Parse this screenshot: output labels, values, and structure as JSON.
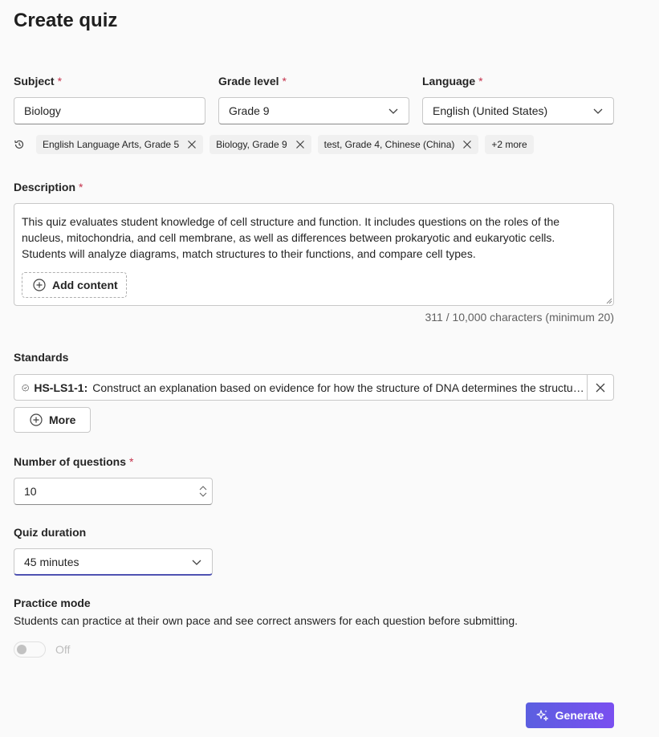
{
  "page": {
    "title": "Create quiz"
  },
  "subject": {
    "label": "Subject",
    "required_mark": "*",
    "value": "Biology"
  },
  "grade": {
    "label": "Grade level",
    "required_mark": "*",
    "value": "Grade 9"
  },
  "language": {
    "label": "Language",
    "required_mark": "*",
    "value": "English (United States)"
  },
  "recent": {
    "icon": "history-icon",
    "chips": [
      {
        "label": "English Language Arts, Grade 5"
      },
      {
        "label": "Biology, Grade 9"
      },
      {
        "label": "test, Grade 4, Chinese (China)"
      }
    ],
    "more_label": "+2 more"
  },
  "description": {
    "label": "Description",
    "required_mark": "*",
    "value": "This quiz evaluates student knowledge of cell structure and function. It includes questions on the roles of the nucleus, mitochondria, and cell membrane, as well as differences between prokaryotic and eukaryotic cells. Students will analyze diagrams, match structures to their functions, and compare cell types.",
    "add_content_label": "Add content",
    "counter": "311 / 10,000 characters (minimum 20)"
  },
  "standards": {
    "label": "Standards",
    "item_code": "HS-LS1-1:",
    "item_text": "Construct an explanation based on evidence for how the structure of DNA determines the structure of proteins which carry out the essential functions of life through systems of specialized cells.",
    "more_label": "More"
  },
  "questions": {
    "label": "Number of questions",
    "required_mark": "*",
    "value": "10"
  },
  "duration": {
    "label": "Quiz duration",
    "value": "45 minutes"
  },
  "practice": {
    "label": "Practice mode",
    "description": "Students can practice at their own pace and see correct answers for each question before submitting.",
    "state_label": "Off",
    "on": false
  },
  "actions": {
    "generate_label": "Generate"
  },
  "colors": {
    "accent": "#5b5fe0",
    "required": "#c4314b",
    "focus_underline": "#4f52b2"
  }
}
